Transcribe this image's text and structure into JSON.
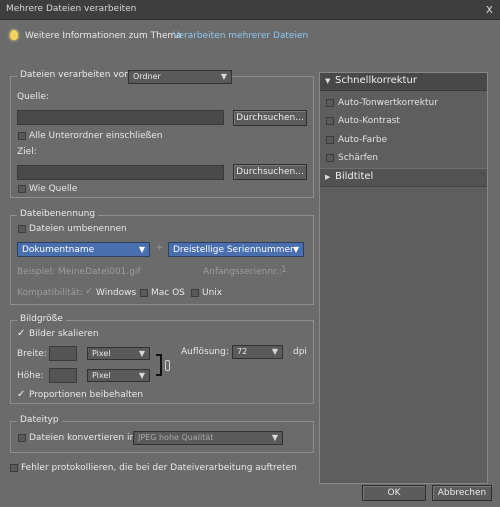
{
  "window": {
    "title": "Mehrere Dateien verarbeiten",
    "close_glyph": "x"
  },
  "help": {
    "text": "Weitere Informationen zum Thema",
    "link": "Verarbeiten mehrerer Dateien"
  },
  "process": {
    "legend": "Dateien verarbeiten von:",
    "source_select": "Ordner",
    "source_label": "Quelle:",
    "source_value": "",
    "browse_label": "Durchsuchen...",
    "include_subfolders_label": "Alle Unterordner einschließen",
    "dest_label": "Ziel:",
    "dest_value": "",
    "browse2_label": "Durchsuchen...",
    "same_as_source_label": "Wie Quelle"
  },
  "naming": {
    "legend": "Dateibenennung",
    "rename_label": "Dateien umbenennen",
    "name_select": "Dokumentname",
    "plus": "+",
    "serial_select": "Dreistellige Seriennummer",
    "example_label": "Beispiel: MeineDatei001.gif",
    "start_serial_label": "Anfangsseriennr.:",
    "start_serial_value": "1",
    "compat_label": "Kompatibilität:",
    "windows_label": "Windows",
    "macos_label": "Mac OS",
    "unix_label": "Unix"
  },
  "image_size": {
    "legend": "Bildgröße",
    "resize_label": "Bilder skalieren",
    "width_label": "Breite:",
    "width_value": "",
    "width_unit": "Pixel",
    "height_label": "Höhe:",
    "height_value": "",
    "height_unit": "Pixel",
    "resolution_label": "Auflösung:",
    "resolution_value": "72",
    "dpi_label": "dpi",
    "constrain_label": "Proportionen beibehalten"
  },
  "filetype": {
    "legend": "Dateityp",
    "convert_label": "Dateien konvertieren in:",
    "format_select": "JPEG hohe Qualität"
  },
  "log_errors_label": "Fehler protokollieren, die bei der Dateiverarbeitung auftreten",
  "quickfix": {
    "title": "Schnellkorrektur",
    "items": [
      "Auto-Tonwertkorrektur",
      "Auto-Kontrast",
      "Auto-Farbe",
      "Schärfen"
    ],
    "labels_title": "Bildtitel"
  },
  "buttons": {
    "ok": "OK",
    "cancel": "Abbrechen"
  },
  "colors": {
    "background": "#6b6b6b",
    "link": "#8ec8f0",
    "selection": "#4a6fae"
  }
}
